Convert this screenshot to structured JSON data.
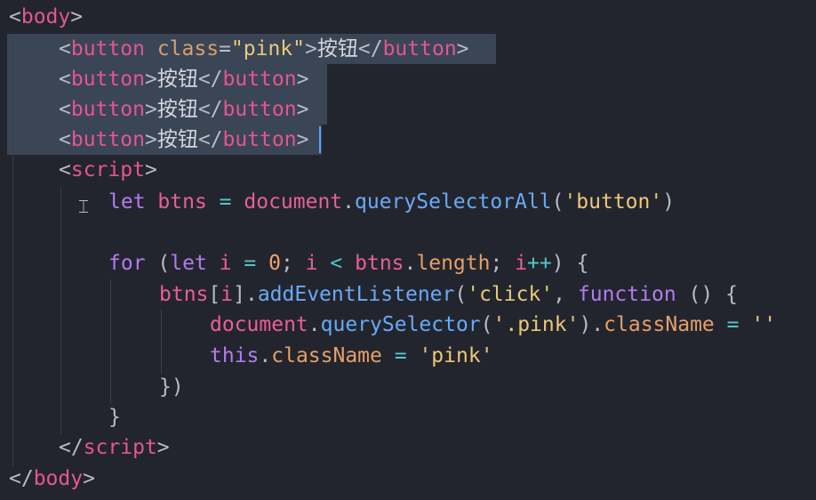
{
  "editor": {
    "colors": {
      "background": "#23252e",
      "selection": "#3a4556",
      "tag": "#e4568f",
      "attribute": "#d8a06b",
      "string": "#e9c979",
      "keyword": "#b27cf0",
      "variable": "#e85f97",
      "function": "#68aaf5",
      "property": "#e59f66",
      "number": "#f2a267",
      "operator": "#50c8c8",
      "caret": "#5aa0ff"
    },
    "code": {
      "body_open": "body",
      "tag_button": "button",
      "attr_class": "class",
      "attr_value": "\"pink\"",
      "button_text": "按钮",
      "tag_script": "script",
      "kw_let": "let",
      "kw_for": "for",
      "kw_function": "function",
      "kw_this": "this",
      "var_btns": "btns",
      "var_i": "i",
      "obj_document": "document",
      "fn_querySelectorAll": "querySelectorAll",
      "fn_addEventListener": "addEventListener",
      "fn_querySelector": "querySelector",
      "str_button": "'button'",
      "str_click": "'click'",
      "str_pink_selector": "'.pink'",
      "str_empty": "''",
      "str_pink": "'pink'",
      "prop_length": "length",
      "prop_className": "className",
      "num_zero": "0",
      "op_assign": "=",
      "op_lt": "<",
      "op_inc": "++"
    },
    "cursor_icon": "text-cursor-icon"
  }
}
